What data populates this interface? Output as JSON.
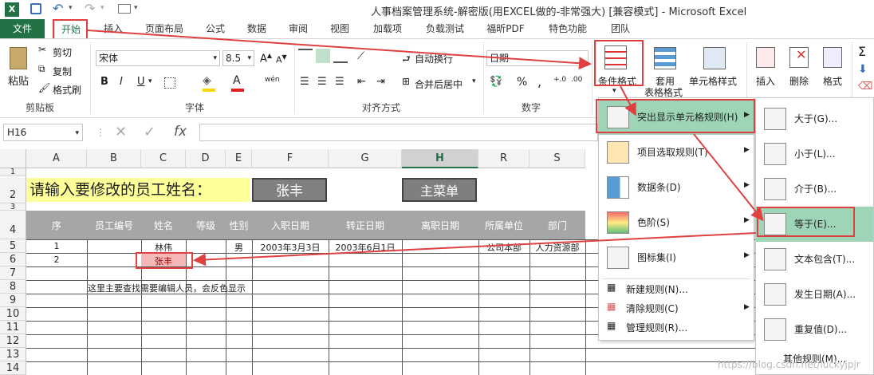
{
  "title_bar": {
    "title": "人事档案管理系统-解密版(用EXCEL做的-非常强大)  [兼容模式] - Microsoft Excel"
  },
  "tabs": [
    {
      "label": "文件"
    },
    {
      "label": "开始"
    },
    {
      "label": "插入"
    },
    {
      "label": "页面布局"
    },
    {
      "label": "公式"
    },
    {
      "label": "数据"
    },
    {
      "label": "审阅"
    },
    {
      "label": "视图"
    },
    {
      "label": "加载项"
    },
    {
      "label": "负载测试"
    },
    {
      "label": "福昕PDF"
    },
    {
      "label": "特色功能"
    },
    {
      "label": "团队"
    }
  ],
  "ribbon": {
    "clipboard": {
      "paste": "粘贴",
      "cut": "剪切",
      "copy": "复制",
      "format_painter": "格式刷",
      "label": "剪贴板"
    },
    "font": {
      "name": "宋体",
      "size": "8.5",
      "label": "字体",
      "bold": "B",
      "italic": "I",
      "underline": "U",
      "font_color_letter": "A",
      "wen": "wén"
    },
    "alignment": {
      "wrap": "自动换行",
      "merge": "合并后居中",
      "label": "对齐方式"
    },
    "number": {
      "format": "日期",
      "label": "数字",
      "percent": "%",
      "comma": ","
    },
    "styles": {
      "cond": "条件格式",
      "table": "套用",
      "table2": "表格格式",
      "cell": "单元格样式"
    },
    "cells": {
      "insert": "插入",
      "delete": "删除",
      "format": "格式"
    }
  },
  "formula_bar": {
    "name_box": "H16",
    "fx": "fx",
    "value": ""
  },
  "columns": [
    "A",
    "B",
    "C",
    "D",
    "E",
    "F",
    "G",
    "H",
    "R",
    "S"
  ],
  "rows": [
    "1",
    "2",
    "3",
    "4",
    "5",
    "6",
    "7",
    "8",
    "9",
    "10",
    "11",
    "12",
    "13",
    "14"
  ],
  "sheet": {
    "prompt": "请输入要修改的员工姓名：",
    "name_input": "张丰",
    "main_menu_btn": "主菜单",
    "headers": [
      "序",
      "员工编号",
      "姓名",
      "等级",
      "性别",
      "入职日期",
      "转正日期",
      "离职日期",
      "所属单位",
      "部门"
    ],
    "row5": [
      "1",
      "",
      "林伟",
      "",
      "男",
      "2003年3月3日",
      "2003年6月1日",
      "",
      "公司本部",
      "人力资源部"
    ],
    "row6": [
      "2",
      "",
      "张丰"
    ],
    "note": "这里主要查找需要编辑人员，会反色显示"
  },
  "menu1": [
    {
      "label": "突出显示单元格规则(H)"
    },
    {
      "label": "项目选取规则(T)"
    },
    {
      "label": "数据条(D)"
    },
    {
      "label": "色阶(S)"
    },
    {
      "label": "图标集(I)"
    }
  ],
  "menu1_bottom": [
    {
      "label": "新建规则(N)..."
    },
    {
      "label": "清除规则(C)"
    },
    {
      "label": "管理规则(R)..."
    }
  ],
  "menu2": [
    {
      "label": "大于(G)..."
    },
    {
      "label": "小于(L)..."
    },
    {
      "label": "介于(B)..."
    },
    {
      "label": "等于(E)..."
    },
    {
      "label": "文本包含(T)..."
    },
    {
      "label": "发生日期(A)..."
    },
    {
      "label": "重复值(D)..."
    }
  ],
  "menu2_more": "其他规则(M)...",
  "watermark": "https://blog.csdn.net/luckyjpjr",
  "colors": {
    "accent": "#217346",
    "highlight": "#e04040",
    "hover": "#9fd5b7"
  }
}
